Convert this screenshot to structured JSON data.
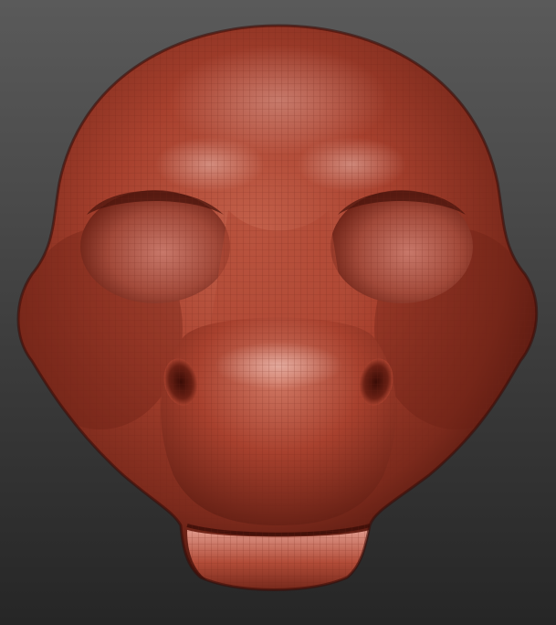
{
  "viewport": {
    "background_top": "#5a5a5a",
    "background_bottom": "#262626"
  },
  "model": {
    "subject": "sculpted-creature-head",
    "material_color": "#a8412e",
    "highlight_color": "#f0c4bc",
    "shadow_color": "#4a140c",
    "wireframe_color": "#7b2a1e",
    "polyframe_visible": true
  }
}
